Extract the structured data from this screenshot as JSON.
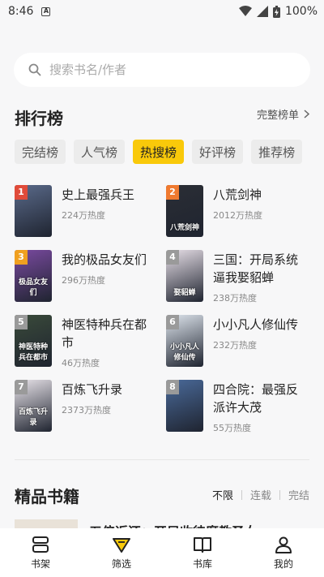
{
  "status": {
    "time": "8:46",
    "battery": "100%"
  },
  "search": {
    "placeholder": "搜索书名/作者"
  },
  "ranking": {
    "title": "排行榜",
    "more": "完整榜单",
    "tabs": [
      "完结榜",
      "人气榜",
      "热搜榜",
      "好评榜",
      "推荐榜"
    ],
    "active_tab": 2,
    "items": [
      {
        "rank": "1",
        "title": "史上最强兵王",
        "heat": "224万热度",
        "cover_text": "",
        "cover_color": "#5a6a8a",
        "badge_color": "#e04b3a"
      },
      {
        "rank": "2",
        "title": "八荒剑神",
        "heat": "2012万热度",
        "cover_text": "八荒剑神",
        "cover_color": "#2b2e35",
        "badge_color": "#f07a30"
      },
      {
        "rank": "3",
        "title": "我的极品女友们",
        "heat": "296万热度",
        "cover_text": "极品女友们",
        "cover_color": "#7a4aa0",
        "badge_color": "#f0a020"
      },
      {
        "rank": "4",
        "title": "三国：开局系统逼我娶貂蝉",
        "heat": "238万热度",
        "cover_text": "娶貂蝉",
        "cover_color": "#e8e0e8",
        "badge_color": "#9a9a9a"
      },
      {
        "rank": "5",
        "title": "神医特种兵在都市",
        "heat": "46万热度",
        "cover_text": "神医特种兵在都市",
        "cover_color": "#3a4a3a",
        "badge_color": "#9a9a9a"
      },
      {
        "rank": "6",
        "title": "小小凡人修仙传",
        "heat": "232万热度",
        "cover_text": "小小凡人修仙传",
        "cover_color": "#dfe6ee",
        "badge_color": "#9a9a9a"
      },
      {
        "rank": "7",
        "title": "百炼飞升录",
        "heat": "2373万热度",
        "cover_text": "百炼飞升录",
        "cover_color": "#e9e4ea",
        "badge_color": "#9a9a9a"
      },
      {
        "rank": "8",
        "title": "四合院：最强反派许大茂",
        "heat": "55万热度",
        "cover_text": "",
        "cover_color": "#4a6a9a",
        "badge_color": "#9a9a9a"
      }
    ]
  },
  "featured": {
    "title": "精品书籍",
    "filters": [
      "不限",
      "连载",
      "完结"
    ],
    "active_filter": 0,
    "peek_title": "五倍返还：开局收徒魔教圣女"
  },
  "nav": [
    {
      "label": "书架",
      "icon": "bookshelf-icon"
    },
    {
      "label": "筛选",
      "icon": "filter-icon"
    },
    {
      "label": "书库",
      "icon": "book-icon"
    },
    {
      "label": "我的",
      "icon": "user-icon"
    }
  ]
}
